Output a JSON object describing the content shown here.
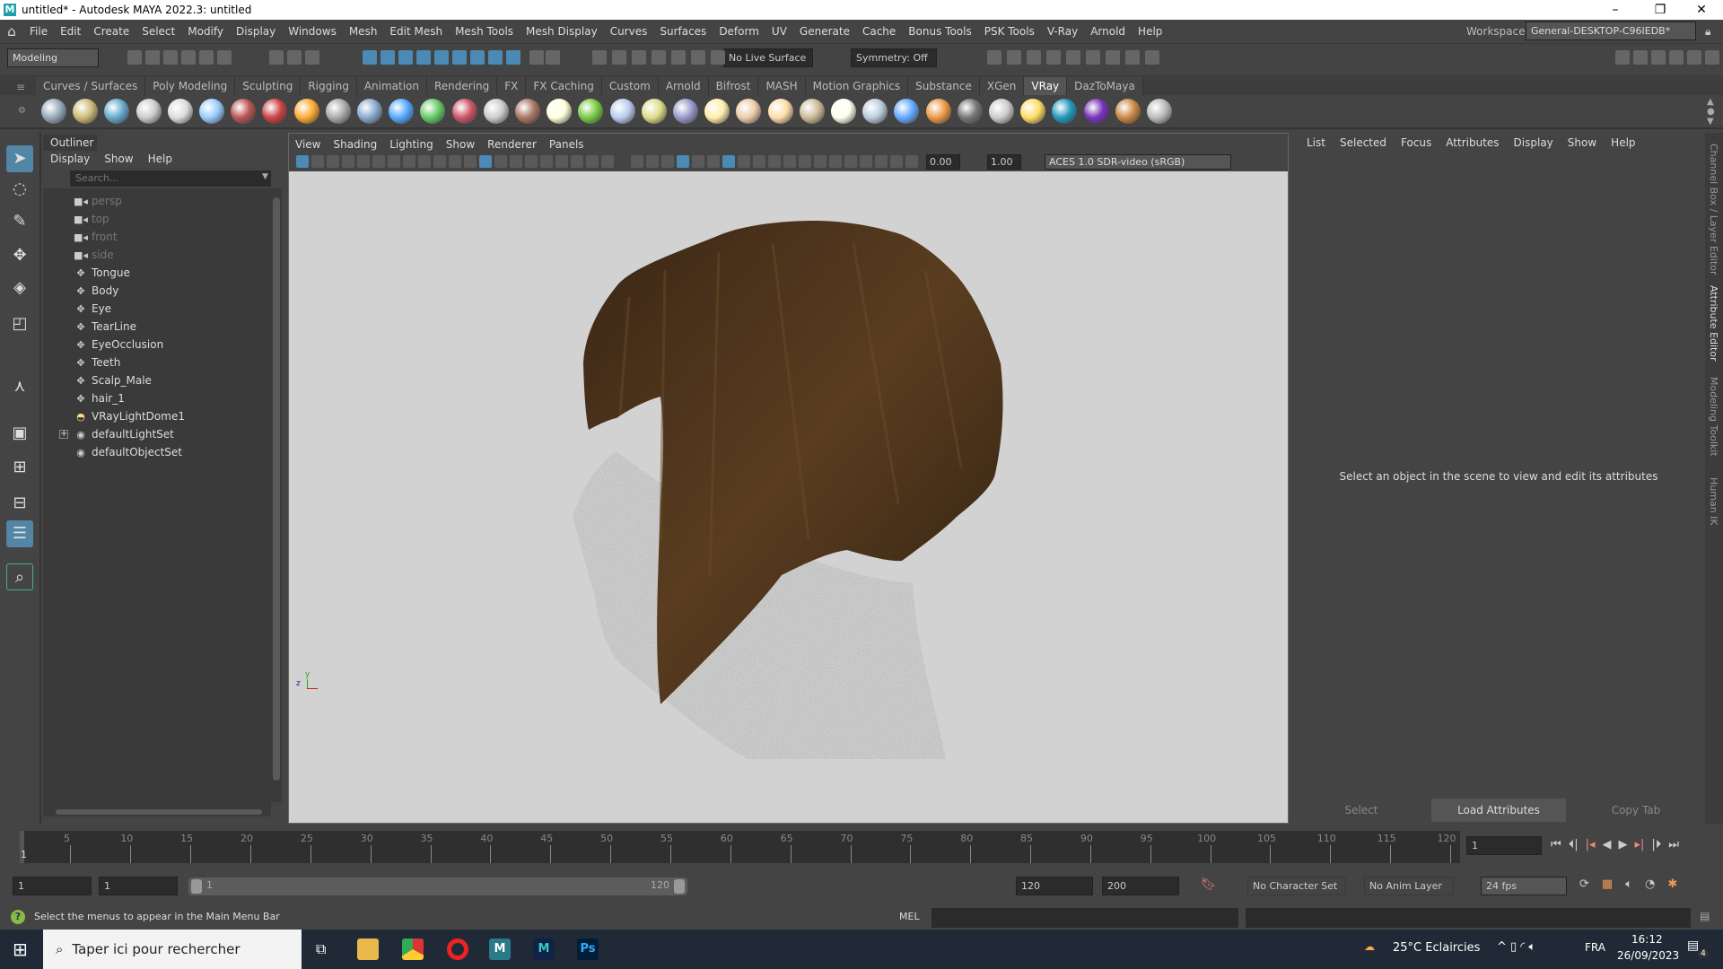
{
  "window": {
    "title": "untitled* - Autodesk MAYA 2022.3: untitled",
    "minimize": "–",
    "restore": "❐",
    "close": "✕"
  },
  "menubar": {
    "items": [
      "File",
      "Edit",
      "Create",
      "Select",
      "Modify",
      "Display",
      "Windows",
      "Mesh",
      "Edit Mesh",
      "Mesh Tools",
      "Mesh Display",
      "Curves",
      "Surfaces",
      "Deform",
      "UV",
      "Generate",
      "Cache",
      "Bonus Tools",
      "PSK Tools",
      "V-Ray",
      "Arnold",
      "Help"
    ],
    "workspace_label": "Workspace:",
    "workspace_value": "General-DESKTOP-C96IEDB*"
  },
  "statusline": {
    "mode": "Modeling",
    "live_surface": "No Live Surface",
    "symmetry": "Symmetry: Off"
  },
  "shelf": {
    "tabs": [
      "Curves / Surfaces",
      "Poly Modeling",
      "Sculpting",
      "Rigging",
      "Animation",
      "Rendering",
      "FX",
      "FX Caching",
      "Custom",
      "Arnold",
      "Bifrost",
      "MASH",
      "Motion Graphics",
      "Substance",
      "XGen",
      "VRay",
      "DazToMaya"
    ],
    "active_tab": "VRay",
    "icon_colors": [
      "#9ab",
      "#cb7",
      "#6ac",
      "#ccc",
      "#ddd",
      "#9cf",
      "#b55",
      "#c44",
      "#fa3",
      "#aaa",
      "#8ac",
      "#5af",
      "#6c6",
      "#c56",
      "#ccc",
      "#a76",
      "#ffd",
      "#7c4",
      "#bce",
      "#dd8",
      "#99c",
      "#fea",
      "#eca",
      "#fda",
      "#cb9",
      "#ffe",
      "#bcd",
      "#6af",
      "#e94",
      "#777",
      "#ccc",
      "#fd6",
      "#29b",
      "#73b",
      "#c84",
      "#bbb"
    ]
  },
  "toolbox": {
    "tools": [
      "select-tool",
      "lasso-tool",
      "paint-select-tool",
      "move-tool",
      "rotate-tool",
      "scale-tool",
      "soft-mod-tool",
      "layout-single",
      "layout-four",
      "layout-two",
      "outliner-layout",
      "search"
    ]
  },
  "outliner": {
    "title": "Outliner",
    "menus": [
      "Display",
      "Show",
      "Help"
    ],
    "search_placeholder": "Search...",
    "items": [
      {
        "label": "persp",
        "icon": "camera",
        "dim": true
      },
      {
        "label": "top",
        "icon": "camera",
        "dim": true
      },
      {
        "label": "front",
        "icon": "camera",
        "dim": true
      },
      {
        "label": "side",
        "icon": "camera",
        "dim": true
      },
      {
        "label": "Tongue",
        "icon": "transform"
      },
      {
        "label": "Body",
        "icon": "transform"
      },
      {
        "label": "Eye",
        "icon": "transform"
      },
      {
        "label": "TearLine",
        "icon": "transform"
      },
      {
        "label": "EyeOcclusion",
        "icon": "transform"
      },
      {
        "label": "Teeth",
        "icon": "transform"
      },
      {
        "label": "Scalp_Male",
        "icon": "transform"
      },
      {
        "label": "hair_1",
        "icon": "transform"
      },
      {
        "label": "VRayLightDome1",
        "icon": "dome-light"
      },
      {
        "label": "defaultLightSet",
        "icon": "set",
        "expand": "+"
      },
      {
        "label": "defaultObjectSet",
        "icon": "set"
      }
    ]
  },
  "viewport": {
    "menus": [
      "View",
      "Shading",
      "Lighting",
      "Show",
      "Renderer",
      "Panels"
    ],
    "exposure": "0.00",
    "gamma": "1.00",
    "color_space": "ACES 1.0 SDR-video (sRGB)",
    "axis_y": "y",
    "axis_z": "z"
  },
  "attribute_editor": {
    "menus": [
      "List",
      "Selected",
      "Focus",
      "Attributes",
      "Display",
      "Show",
      "Help"
    ],
    "message": "Select an object in the scene to view and edit its attributes",
    "buttons": [
      "Select",
      "Load Attributes",
      "Copy Tab"
    ]
  },
  "side_tabs": [
    "Channel Box / Layer Editor",
    "Attribute Editor",
    "Modeling Toolkit",
    "Human IK"
  ],
  "timeline": {
    "start": 1,
    "end": 120,
    "current_frame": "1",
    "labels": [
      5,
      10,
      15,
      20,
      25,
      30,
      35,
      40,
      45,
      50,
      55,
      60,
      65,
      70,
      75,
      80,
      85,
      90,
      95,
      100,
      105,
      110,
      115,
      120
    ],
    "current_label": "1"
  },
  "range": {
    "start": "1",
    "playback_start": "1",
    "slider_start": "1",
    "slider_end": "120",
    "playback_end": "120",
    "end": "200",
    "character_set": "No Character Set",
    "anim_layer": "No Anim Layer",
    "fps": "24 fps"
  },
  "command": {
    "help_text": "Select the menus to appear in the Main Menu Bar",
    "language": "MEL"
  },
  "taskbar": {
    "search_placeholder": "Taper ici pour rechercher",
    "weather": "25°C  Eclaircies",
    "language": "FRA",
    "time": "16:12",
    "date": "26/09/2023",
    "notifications": "4",
    "apps": [
      "file-explorer",
      "chrome",
      "opera",
      "maya-launcher",
      "maya",
      "photoshop"
    ]
  }
}
